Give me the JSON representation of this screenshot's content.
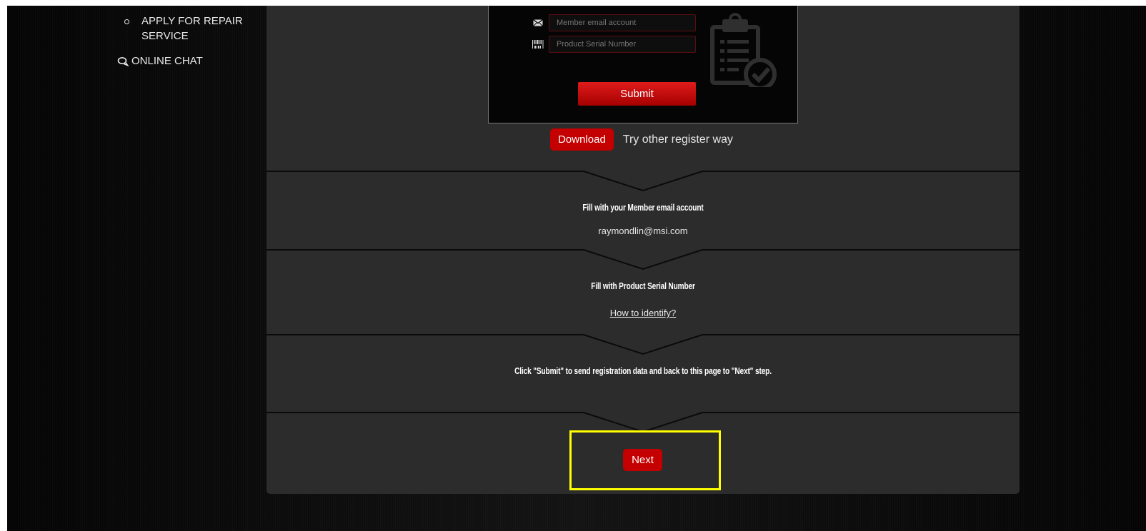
{
  "sidebar": {
    "repair_item": "APPLY FOR REPAIR SERVICE",
    "chat_item": "ONLINE CHAT"
  },
  "form": {
    "email_placeholder": "Member email account",
    "serial_placeholder": "Product Serial Number",
    "submit_label": "Submit"
  },
  "alt_register": {
    "download_label": "Download",
    "text": "Try other register way"
  },
  "steps": {
    "email_title": "Fill with your Member email account",
    "email_value": "raymondlin@msi.com",
    "serial_title": "Fill with Product Serial Number",
    "serial_link": "How to identify?",
    "submit_instruction": "Click \"Submit\" to send registration data and back to this page to \"Next\" step.",
    "next_label": "Next"
  },
  "colors": {
    "accent_red": "#c40000",
    "highlight": "#ffff00",
    "panel": "#2c2c2c"
  },
  "icons": [
    "chat-bubbles-icon",
    "envelope-icon",
    "barcode-icon",
    "clipboard-check-icon"
  ]
}
